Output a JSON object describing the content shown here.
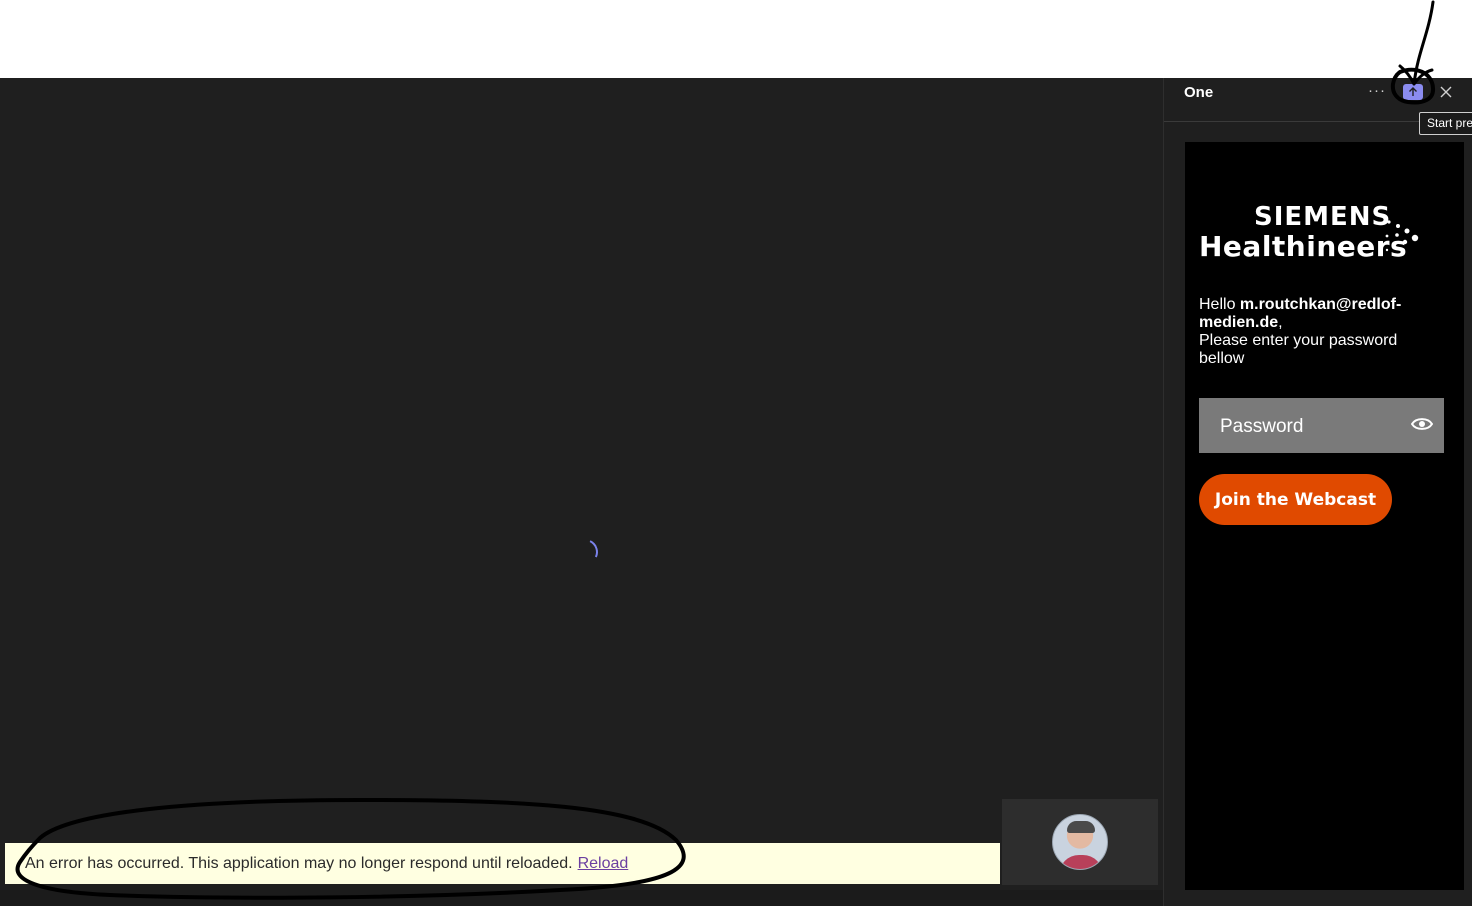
{
  "meeting": {
    "loading_spinner": "loading-spinner"
  },
  "error_bar": {
    "message": "An error has occurred. This application may no longer respond until reloaded.",
    "reload_label": "Reload"
  },
  "video_tile": {
    "avatar_icon": "participant-avatar"
  },
  "side_panel": {
    "title": "One",
    "more_label": "···",
    "present_icon": "share-up-arrow-icon",
    "close_icon": "close-icon",
    "tooltip": "Start pre"
  },
  "app": {
    "logo_line1": "SIEMENS",
    "logo_line2": "Healthineers",
    "greeting_prefix": "Hello ",
    "email": "m.routchkan@redlof-medien.de",
    "greeting_comma": ",",
    "instruction": "Please enter your password bellow",
    "password_placeholder": "Password",
    "eye_icon": "show-password-eye-icon",
    "join_label": "Join the Webcast",
    "brand_color": "#e04a00"
  },
  "colors": {
    "stage_bg": "#1f1f1f",
    "error_bg": "#ffffe1",
    "present_button": "#8b8cf0"
  }
}
